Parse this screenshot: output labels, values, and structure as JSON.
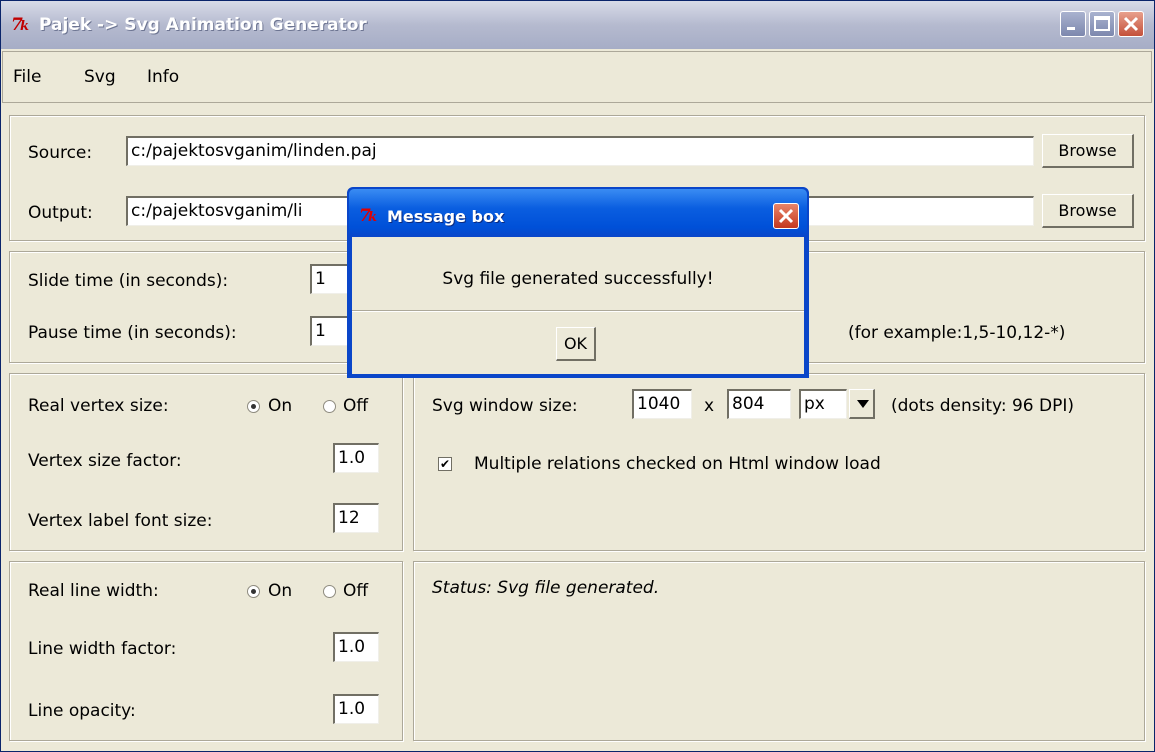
{
  "window": {
    "title": "Pajek -> Svg Animation Generator"
  },
  "menu": {
    "file": "File",
    "svg": "Svg",
    "info": "Info"
  },
  "paths": {
    "source_label": "Source:",
    "source_value": "c:/pajektosvganim/linden.paj",
    "output_label": "Output:",
    "output_value": "c:/pajektosvganim/li",
    "browse_label": "Browse"
  },
  "timing": {
    "slide_label": "Slide time (in seconds):",
    "slide_value": "1",
    "pause_label": "Pause time (in seconds):",
    "pause_value": "1",
    "example_text": "(for example:1,5-10,12-*)"
  },
  "vertex": {
    "real_size_label": "Real vertex size:",
    "on_label": "On",
    "off_label": "Off",
    "selected": "On",
    "size_factor_label": "Vertex size factor:",
    "size_factor_value": "1.0",
    "font_size_label": "Vertex label font size:",
    "font_size_value": "12"
  },
  "svg_window": {
    "label": "Svg window size:",
    "width_value": "1040",
    "x_sep": "x",
    "height_value": "804",
    "unit_value": "px",
    "density_text": "(dots density: 96 DPI)",
    "multi_rel_label": "Multiple relations checked on Html window load",
    "multi_rel_checked": true
  },
  "line": {
    "real_width_label": "Real line width:",
    "on_label": "On",
    "off_label": "Off",
    "selected": "On",
    "width_factor_label": "Line width factor:",
    "width_factor_value": "1.0",
    "opacity_label": "Line opacity:",
    "opacity_value": "1.0"
  },
  "status": {
    "text": "Status: Svg file generated."
  },
  "dialog": {
    "title": "Message box",
    "message": "Svg file generated successfully!",
    "ok_label": "OK"
  },
  "colors": {
    "titlebar_inactive": "#b5bacf",
    "dialog_title": "#0a46c9",
    "window_bg": "#ece9d8",
    "close_red": "#c4381f"
  },
  "icons": {
    "app_icon": "tk-feather-icon",
    "minimize": "minimize-icon",
    "maximize": "maximize-icon",
    "close": "close-icon"
  }
}
